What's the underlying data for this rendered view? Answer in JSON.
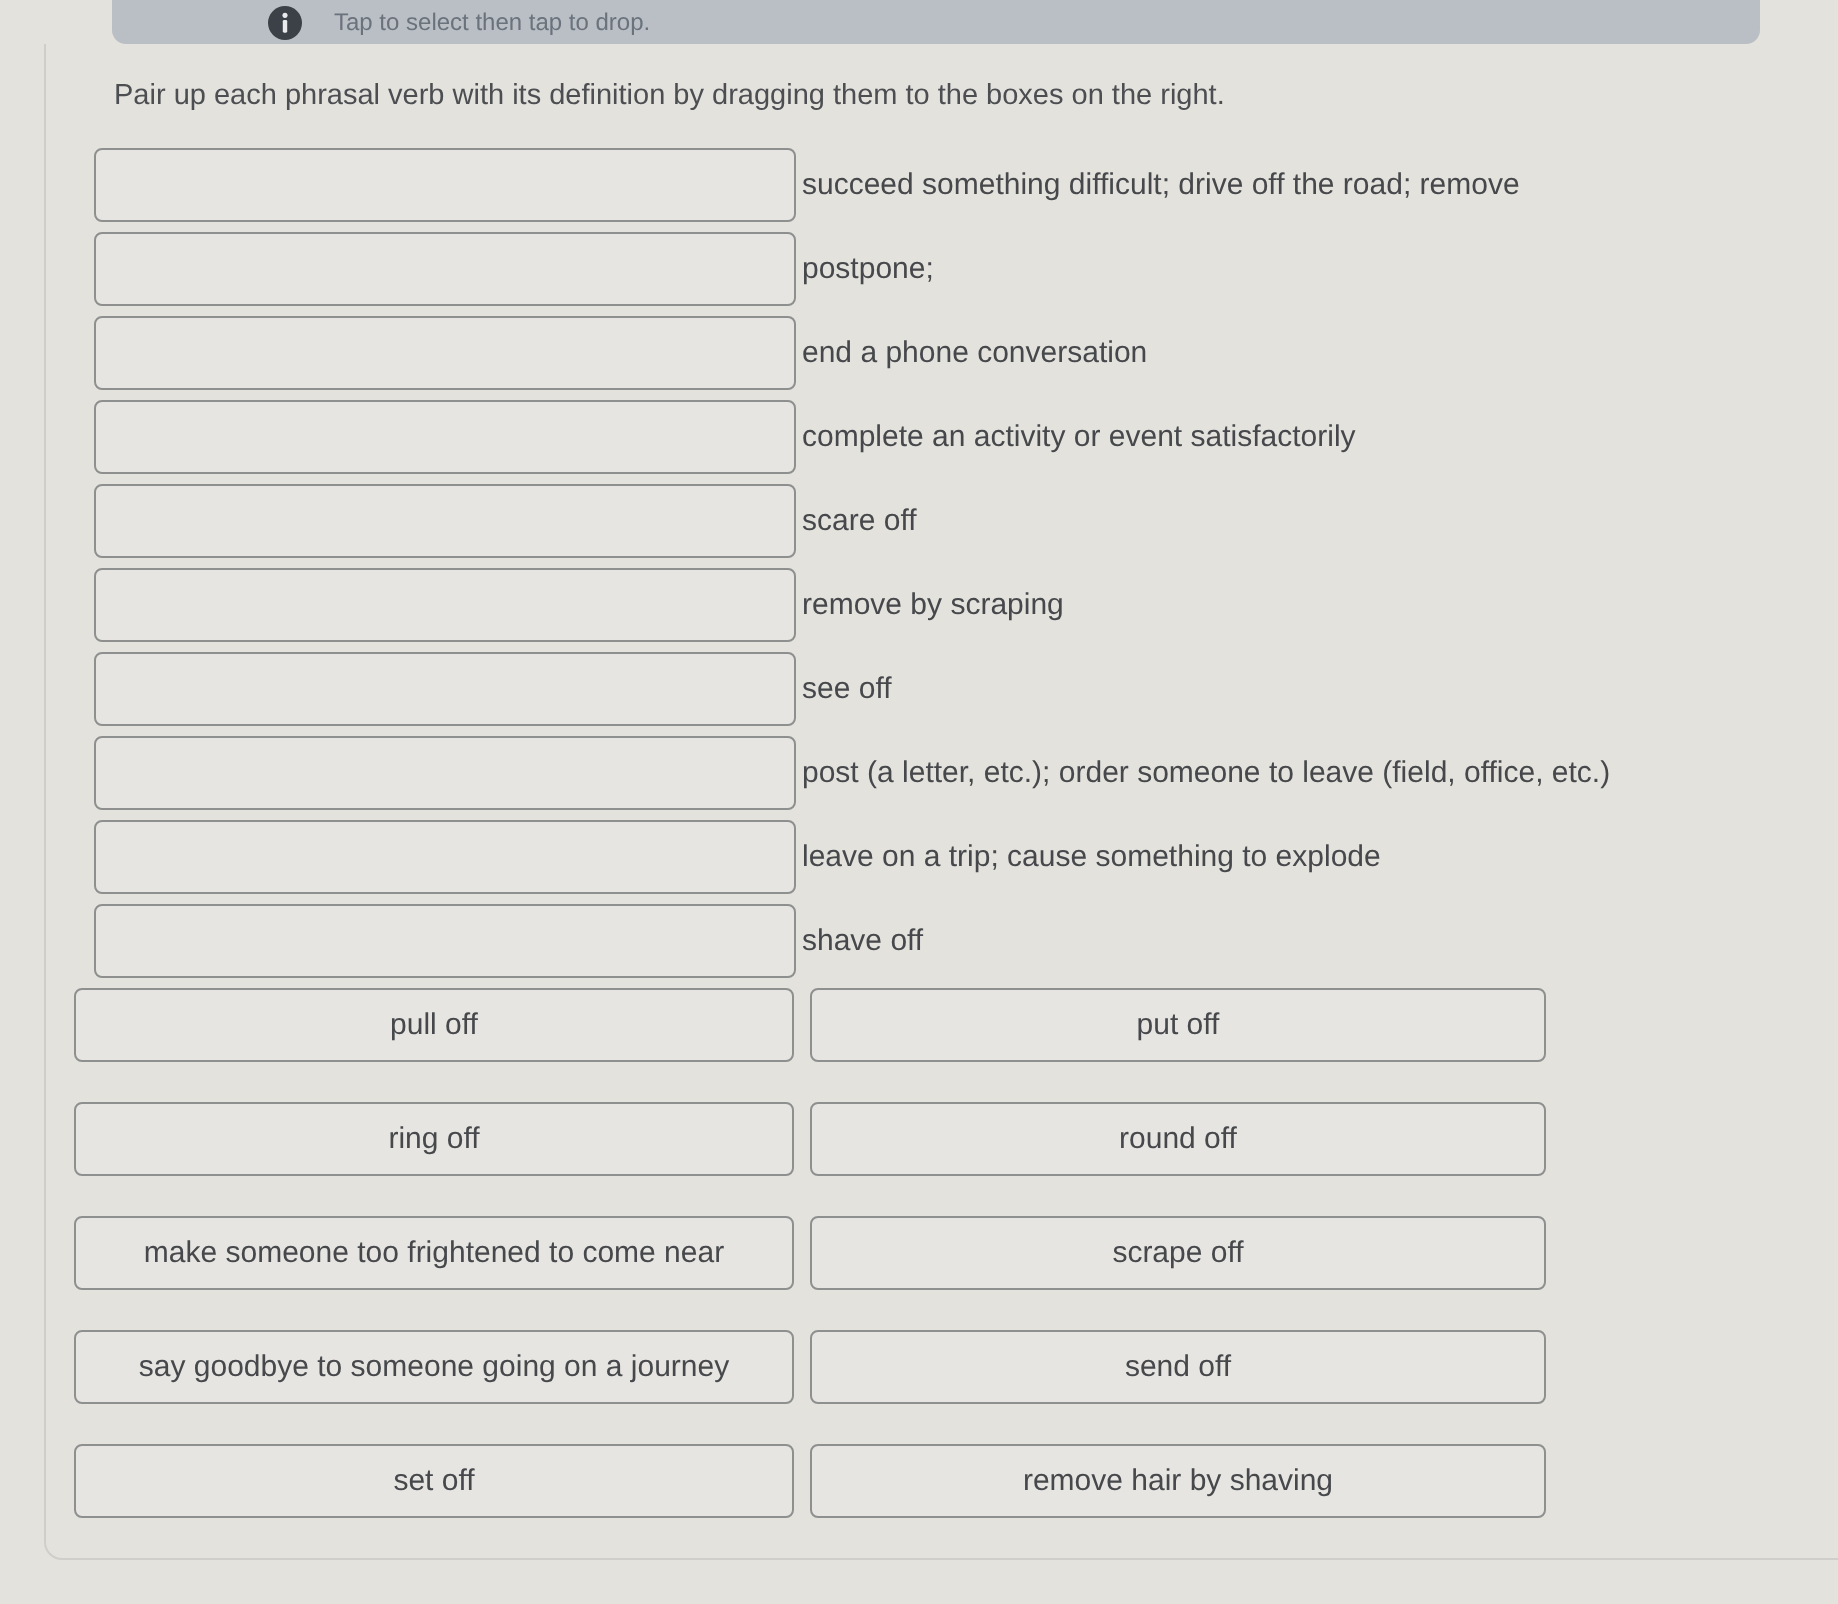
{
  "banner": {
    "text": "Tap to select then tap to drop."
  },
  "instruction": "Pair up each phrasal verb with its definition by dragging them to the boxes on the right.",
  "matches": [
    {
      "definition": "succeed something difficult; drive off the road; remove"
    },
    {
      "definition": "postpone;"
    },
    {
      "definition": "end a phone conversation"
    },
    {
      "definition": "complete an activity or event satisfactorily"
    },
    {
      "definition": "scare off"
    },
    {
      "definition": "remove by scraping"
    },
    {
      "definition": "see off"
    },
    {
      "definition": "post (a letter, etc.); order someone to leave (field, office, etc.)"
    },
    {
      "definition": "leave on a trip; cause something to explode"
    },
    {
      "definition": "shave off"
    }
  ],
  "tiles": [
    {
      "text": "pull off"
    },
    {
      "text": "put off"
    },
    {
      "text": "ring off"
    },
    {
      "text": "round off"
    },
    {
      "text": "make someone too frightened to come near"
    },
    {
      "text": "scrape off"
    },
    {
      "text": "say goodbye to someone going on a journey"
    },
    {
      "text": "send off"
    },
    {
      "text": "set off"
    },
    {
      "text": "remove hair by shaving"
    }
  ]
}
